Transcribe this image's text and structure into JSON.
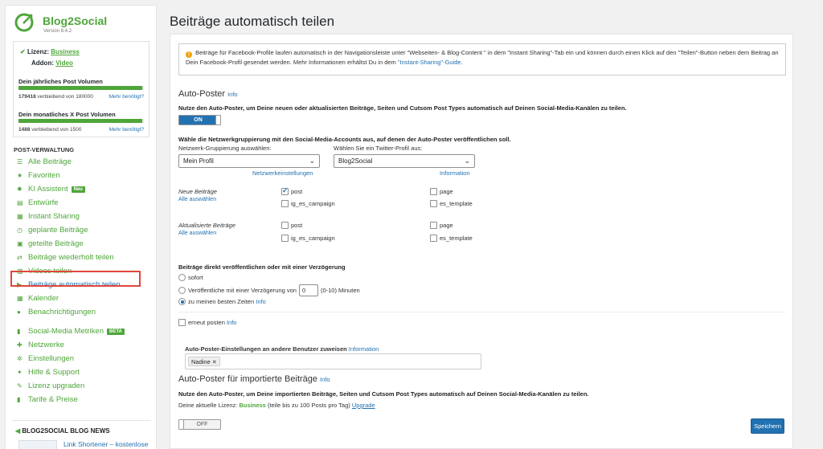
{
  "sidebar": {
    "brand": {
      "name": "Blog2Social",
      "version": "Version 8.4.2"
    },
    "license": {
      "label": "Lizenz:",
      "value": "Business",
      "addon_label": "Addon:",
      "addon_value": "Video"
    },
    "annual": {
      "title": "Dein jährliches Post Volumen",
      "remaining_value": "179418",
      "remaining_text": "verbleibend von 180000",
      "more": "Mehr benötigt?",
      "fill": 0.99
    },
    "monthly": {
      "title": "Dein monatliches X Post Volumen",
      "remaining_value": "1488",
      "remaining_text": "verbleibend von 1500",
      "more": "Mehr benötigt?",
      "fill": 0.99
    },
    "menu_title": "POST-VERWALTUNG",
    "menu": [
      {
        "label": "Alle Beiträge",
        "icon": "list-icon"
      },
      {
        "label": "Favoriten",
        "icon": "star-icon"
      },
      {
        "label": "KI Assistent",
        "icon": "ai-icon",
        "badge": "Neu"
      },
      {
        "label": "Entwürfe",
        "icon": "draft-icon"
      },
      {
        "label": "Instant Sharing",
        "icon": "share-icon"
      },
      {
        "label": "geplante Beiträge",
        "icon": "clock-icon"
      },
      {
        "label": "geteilte Beiträge",
        "icon": "shared-icon"
      },
      {
        "label": "Beiträge wiederholt teilen",
        "icon": "repeat-icon"
      },
      {
        "label": "Videos teilen",
        "icon": "video-icon"
      },
      {
        "label": "Beiträge automatisch teilen",
        "icon": "play-icon"
      },
      {
        "label": "Kalender",
        "icon": "calendar-icon"
      },
      {
        "label": "Benachrichtigungen",
        "icon": "bell-icon"
      }
    ],
    "menu2": [
      {
        "label": "Social-Media Metriken",
        "icon": "chart-icon",
        "badge": "BETA"
      },
      {
        "label": "Netzwerke",
        "icon": "network-icon"
      },
      {
        "label": "Einstellungen",
        "icon": "gear-icon"
      },
      {
        "label": "Hilfe & Support",
        "icon": "help-icon"
      },
      {
        "label": "Lizenz upgraden",
        "icon": "key-icon"
      },
      {
        "label": "Tarife & Preise",
        "icon": "pricing-icon"
      }
    ],
    "news_title": "BLOG2SOCIAL BLOG NEWS",
    "news_link": "Link Shortener – kostenlose und Premium Tools im"
  },
  "main": {
    "title": "Beiträge automatisch teilen",
    "notice": {
      "text1": "Beiträge für Facebook-Profile laufen automatisch in der Navigationsleiste unter \"Webseiten- & Blog-Content \" in dem \"Instant Sharing\"-Tab ein und können durch einen Klick auf den \"Teilen\"-Button neben dem Beitrag an Dein Facebook-Profil gesendet werden. Mehr Informationen erhältst Du in dem ",
      "link": "\"Instant-Sharing\"-Guide",
      "text2": "."
    },
    "autoposter": {
      "title": "Auto-Poster",
      "info": "Info",
      "desc": "Nutze den Auto-Poster, um Deine neuen oder aktualisierten Beiträge, Seiten und Cutsom Post Types automatisch auf Deinen Social-Media-Kanälen zu teilen.",
      "toggle": "ON",
      "choose": "Wähle die Netzwerkgruppierung mit den Social-Media-Accounts aus, auf denen der Auto-Poster veröffentlichen soll.",
      "group_label": "Netzwerk-Gruppierung auswählen:",
      "group_value": "Mein Profil",
      "group_link": "Netzwerkeinstellungen",
      "twitter_label": "Wählen Sie ein Twitter-Profil aus:",
      "twitter_value": "Blog2Social",
      "twitter_link": "Information",
      "new_label": "Neue Beiträge",
      "updated_label": "Aktualisierte Beiträge",
      "select_all": "Alle auswählen",
      "post": "post",
      "page": "page",
      "ig": "ig_es_campaign",
      "es": "es_template",
      "delay_title": "Beiträge direkt veröffentlichen oder mit einer Verzögerung",
      "opt_now": "sofort",
      "opt_delay": "Veröffentliche mit einer Verzögerung von",
      "delay_value": "0",
      "delay_unit": "(0-10) Minuten",
      "opt_best": "zu meinen besten Zeiten",
      "opt_best_info": "Info",
      "repost": "erneut posten",
      "repost_info": "Info",
      "assign": "Auto-Poster-Einstellungen an andere Benutzer zuweisen",
      "assign_info": "Information",
      "tag": "Nadine"
    },
    "imported": {
      "title": "Auto-Poster für importierte Beiträge",
      "info": "Info",
      "desc": "Nutze den Auto-Poster, um Deine importierten Beiträge, Seiten und Cutsom Post Types automatisch auf Deinen Social-Media-Kanälen zu teilen.",
      "license_text": "Deine aktuelle Lizenz:",
      "license_value": "Business",
      "license_detail": "(teile bis zu 100 Posts pro Tag)",
      "upgrade": "Upgrade",
      "toggle": "OFF"
    },
    "save": "Speichern"
  }
}
